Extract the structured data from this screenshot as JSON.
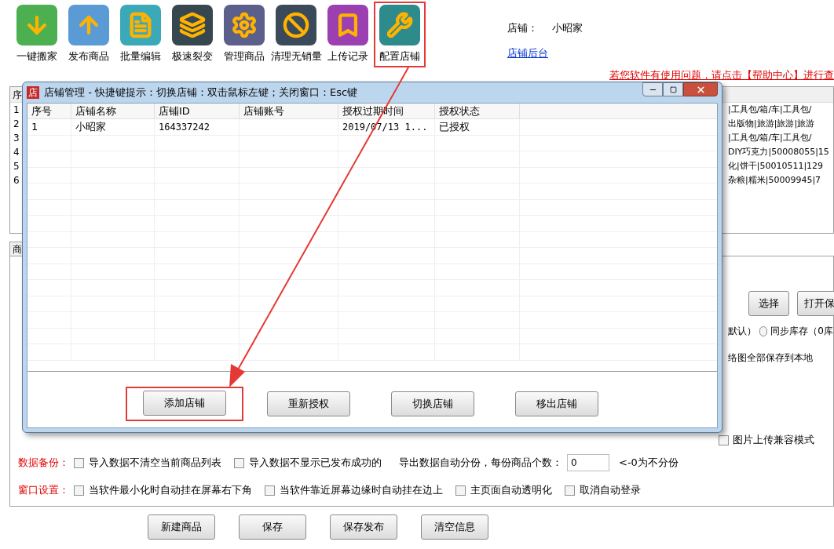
{
  "toolbar": [
    {
      "kind": "download",
      "label": "一键搬家",
      "highlighted": false
    },
    {
      "kind": "upload",
      "label": "发布商品",
      "highlighted": false
    },
    {
      "kind": "notepad",
      "label": "批量编辑",
      "highlighted": false
    },
    {
      "kind": "layers",
      "label": "极速裂变",
      "highlighted": false
    },
    {
      "kind": "gear",
      "label": "管理商品",
      "highlighted": false
    },
    {
      "kind": "forbidden",
      "label": "清理无销量",
      "highlighted": false
    },
    {
      "kind": "bookmark",
      "label": "上传记录",
      "highlighted": false
    },
    {
      "kind": "tools",
      "label": "配置店铺",
      "highlighted": true
    }
  ],
  "store": {
    "label": "店铺：",
    "name": "小昭家",
    "link": "店铺后台"
  },
  "help_text": "若您软件有使用问题，请点击【帮助中心】进行查",
  "product_list": {
    "header": "序",
    "rows": [
      {
        "number": "1",
        "text": "|工具包/箱/车|工具包/"
      },
      {
        "number": "2",
        "text": "出版物|旅游|旅游|旅游"
      },
      {
        "number": "3",
        "text": "|工具包/箱/车|工具包/"
      },
      {
        "number": "4",
        "text": "DIY巧克力|50008055|15"
      },
      {
        "number": "5",
        "text": "化|饼干|50010511|129"
      },
      {
        "number": "6",
        "text": "杂粮|糯米|50009945|7"
      }
    ]
  },
  "tab_label": "商",
  "settings": {
    "select_button": "选择",
    "open_button": "打开保",
    "default_fragment": "默认）",
    "sync_stock": {
      "label": "同步库存（0库",
      "selected": false
    },
    "save_fragment": "络图全部保存到本地",
    "image_compat": {
      "label": "图片上传兼容模式",
      "checked": false
    }
  },
  "backup": {
    "label": "数据备份：",
    "options": [
      {
        "label": "导入数据不清空当前商品列表",
        "checked": false
      },
      {
        "label": "导入数据不显示已发布成功的",
        "checked": false
      }
    ],
    "split_label": "导出数据自动分份，每份商品个数：",
    "split_value": "0",
    "split_hint": "<-0为不分份"
  },
  "window_settings": {
    "label": "窗口设置：",
    "options": [
      {
        "label": "当软件最小化时自动挂在屏幕右下角",
        "checked": false
      },
      {
        "label": "当软件靠近屏幕边缘时自动挂在边上",
        "checked": false
      },
      {
        "label": "主页面自动透明化",
        "checked": false
      },
      {
        "label": "取消自动登录",
        "checked": false
      }
    ]
  },
  "buttons": [
    "新建商品",
    "保存",
    "保存发布",
    "清空信息"
  ],
  "dialog": {
    "icon_text": "店",
    "title": "店铺管理 - 快捷键提示：切换店铺：双击鼠标左键；关闭窗口：Esc键",
    "columns": [
      "序号",
      "店铺名称",
      "店铺ID",
      "店铺账号",
      "授权过期时间",
      "授权状态"
    ],
    "rows": [
      [
        "1",
        "小昭家",
        "164337242",
        "",
        "2019/07/13 1...",
        "已授权"
      ]
    ],
    "buttons": [
      {
        "label": "添加店铺",
        "highlighted": true
      },
      {
        "label": "重新授权",
        "highlighted": false
      },
      {
        "label": "切换店铺",
        "highlighted": false
      },
      {
        "label": "移出店铺",
        "highlighted": false
      }
    ]
  }
}
